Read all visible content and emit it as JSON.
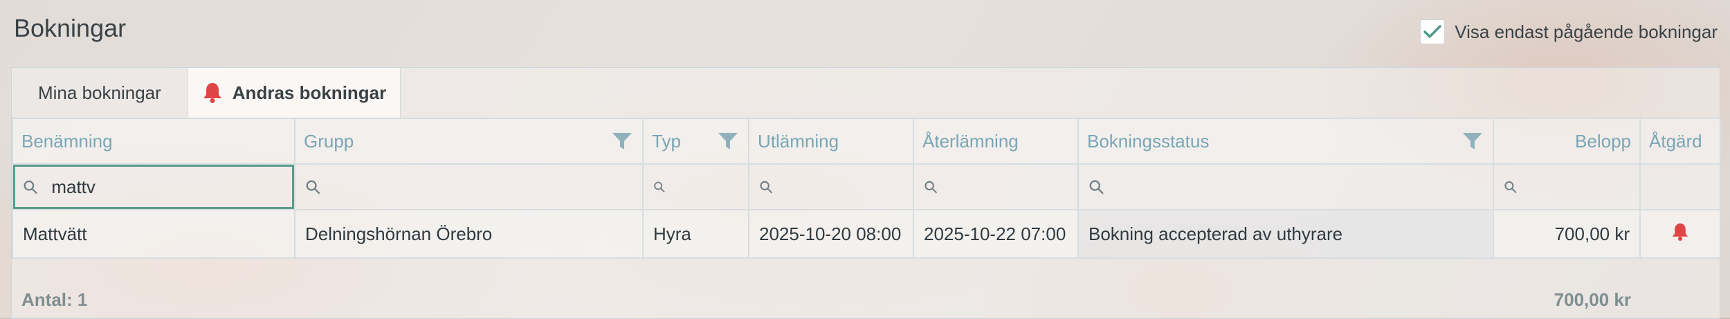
{
  "page": {
    "title": "Bokningar"
  },
  "toggle": {
    "label": "Visa endast pågående bokningar",
    "checked": true
  },
  "tabs": [
    {
      "label": "Mina bokningar"
    },
    {
      "label": "Andras bokningar",
      "icon": "bell-icon"
    }
  ],
  "columns": {
    "name": "Benämning",
    "group": "Grupp",
    "type": "Typ",
    "pickup": "Utlämning",
    "return": "Återlämning",
    "status": "Bokningsstatus",
    "amount": "Belopp",
    "action": "Åtgärd"
  },
  "search": {
    "name_value": "mattv"
  },
  "rows": [
    {
      "name": "Mattvätt",
      "group": "Delningshörnan Örebro",
      "type": "Hyra",
      "pickup": "2025-10-20 08:00",
      "return": "2025-10-22 07:00",
      "status": "Bokning accepterad av uthyrare",
      "amount": "700,00 kr",
      "action_icon": "bell-icon"
    }
  ],
  "footer": {
    "count": "Antal: 1",
    "total": "700,00 kr"
  },
  "colors": {
    "accent": "#4a9a8c",
    "bell": "#e04545",
    "header_text": "#7aa6b6"
  }
}
